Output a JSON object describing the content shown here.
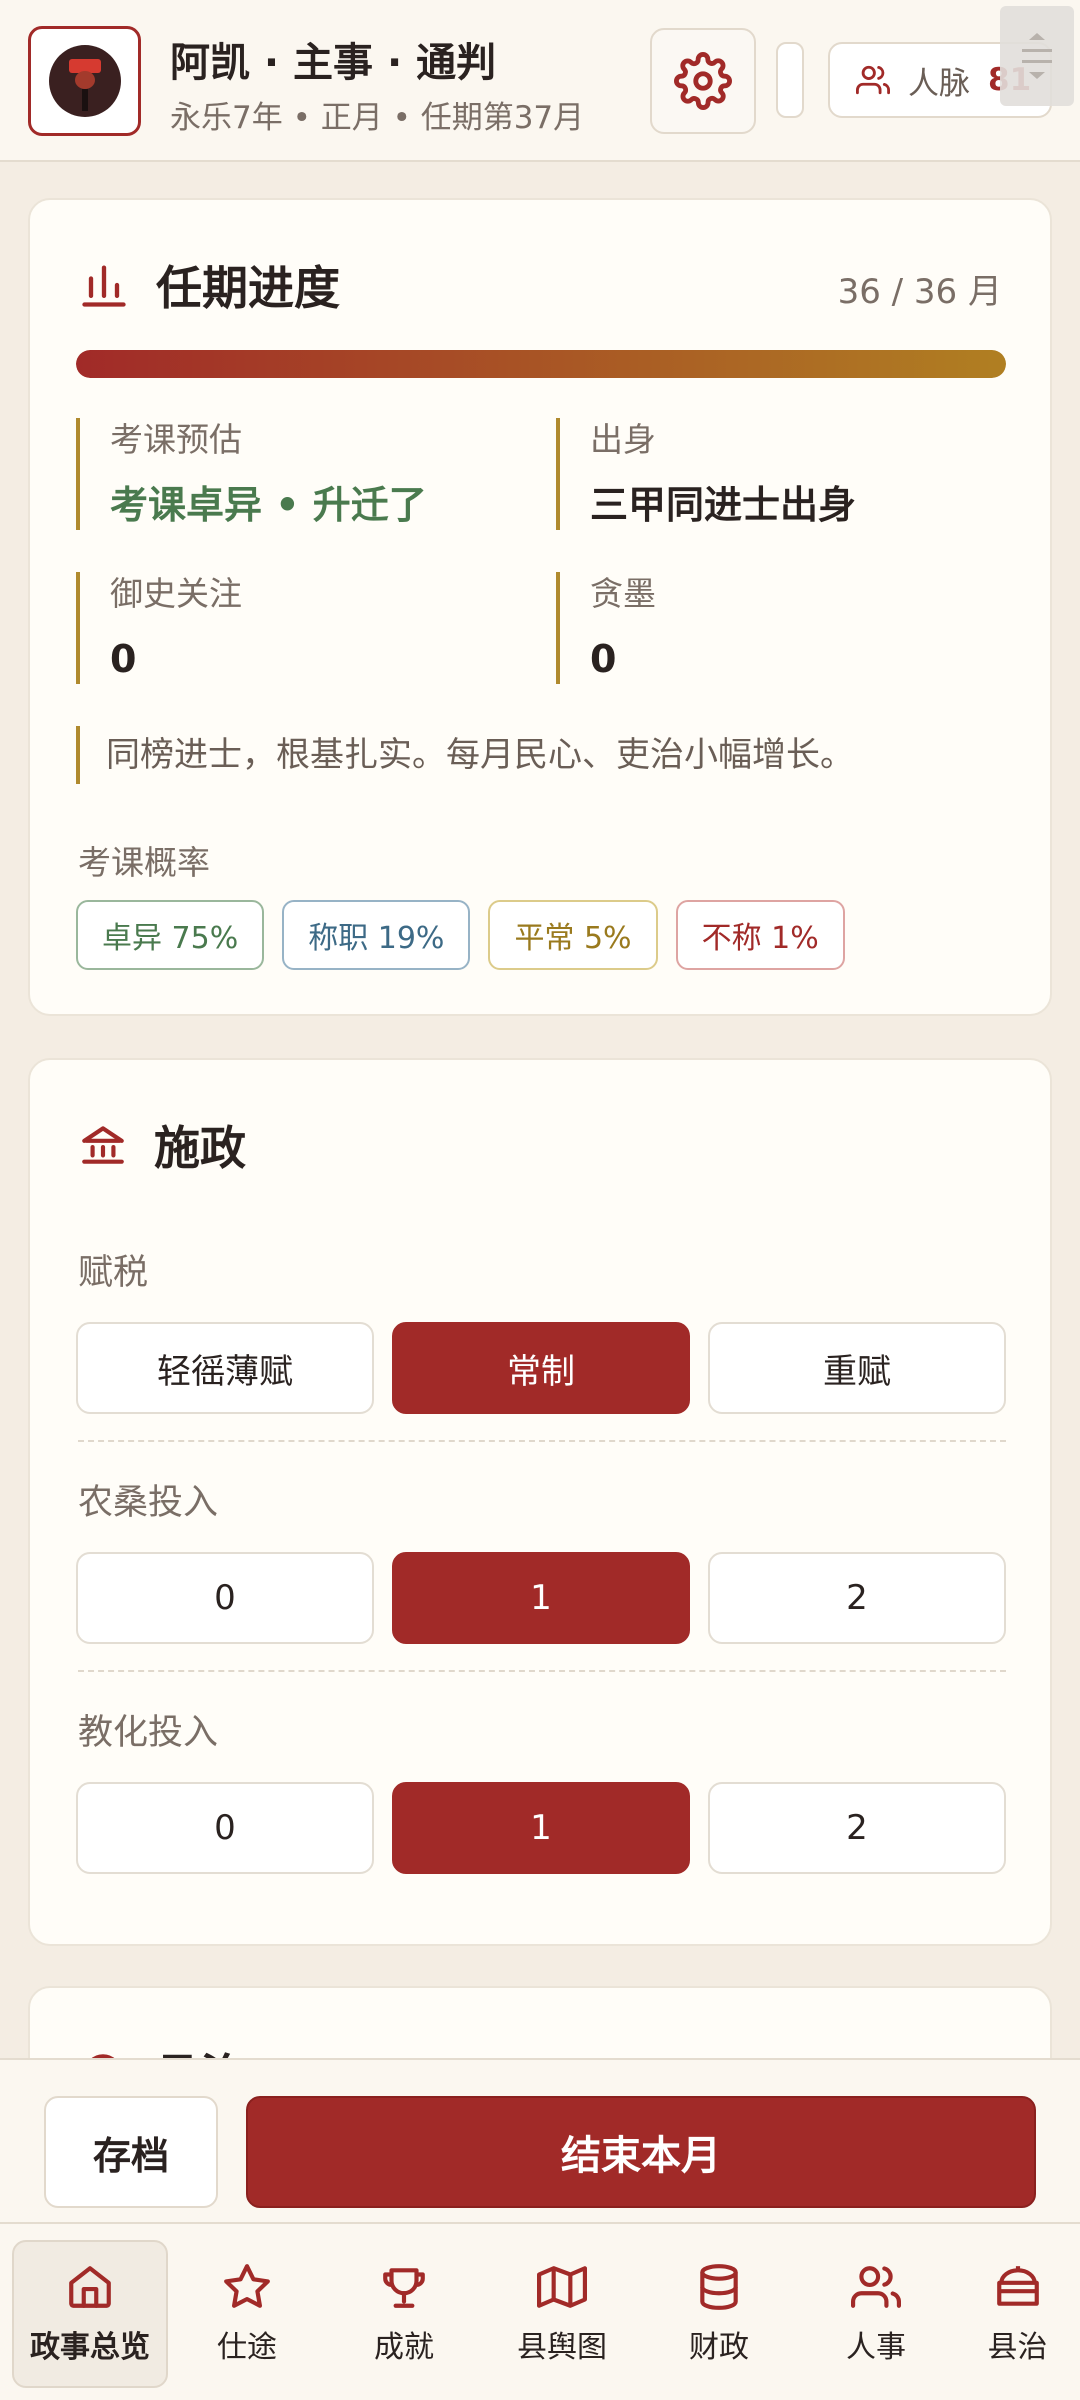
{
  "header": {
    "title": "阿凯 · 主事 · 通判",
    "subtitle": "永乐7年 • 正月 • 任期第37月",
    "renmai_label": "人脉",
    "renmai_value": "81"
  },
  "tenure": {
    "title": "任期进度",
    "count": "36 / 36 月",
    "progress_fraction": 1.0,
    "stats": [
      {
        "label": "考课预估",
        "value": "考课卓异 • 升迁了"
      },
      {
        "label": "出身",
        "value": "三甲同进士出身"
      },
      {
        "label": "御史关注",
        "value": "0"
      },
      {
        "label": "贪墨",
        "value": "0"
      }
    ],
    "note": "同榜进士，根基扎实。每月民心、吏治小幅增长。",
    "prob_label": "考课概率",
    "probs": [
      "卓异 75%",
      "称职 19%",
      "平常 5%",
      "不称 1%"
    ]
  },
  "policy": {
    "title": "施政",
    "tax": {
      "label": "赋税",
      "options": [
        "轻徭薄赋",
        "常制",
        "重赋"
      ],
      "selected": "常制"
    },
    "agri": {
      "label": "农桑投入",
      "options": [
        "0",
        "1",
        "2"
      ],
      "selected": "1"
    },
    "edu": {
      "label": "教化投入",
      "options": [
        "0",
        "1",
        "2"
      ],
      "selected": "1"
    },
    "next_card_title": "县治"
  },
  "actions": {
    "save": "存档",
    "end_month": "结束本月"
  },
  "nav": [
    {
      "label": "政事总览",
      "icon": "home-icon",
      "active": true
    },
    {
      "label": "仕途",
      "icon": "star-icon"
    },
    {
      "label": "成就",
      "icon": "trophy-icon"
    },
    {
      "label": "县舆图",
      "icon": "map-icon"
    },
    {
      "label": "财政",
      "icon": "database-icon"
    },
    {
      "label": "人事",
      "icon": "users-icon"
    },
    {
      "label": "县治",
      "icon": "building-icon"
    }
  ],
  "colors": {
    "accent": "#a12a28",
    "gold": "#b08a2e",
    "green": "#4a7a4e",
    "background": "#f4ede3"
  }
}
